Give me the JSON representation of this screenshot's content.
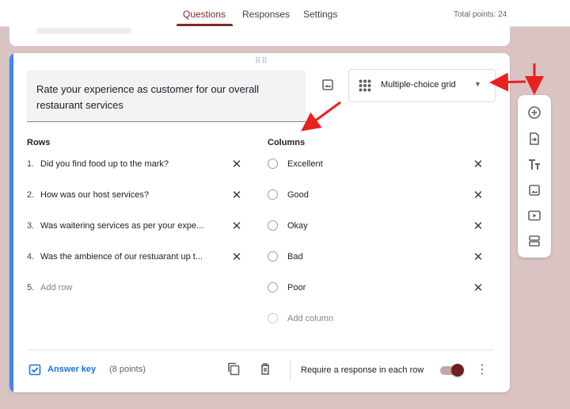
{
  "header": {
    "tabs": [
      {
        "label": "Questions",
        "active": true
      },
      {
        "label": "Responses",
        "active": false
      },
      {
        "label": "Settings",
        "active": false
      }
    ],
    "total_points": "Total points: 24"
  },
  "question": {
    "title": "Rate your experience as customer for our overall restaurant services",
    "type": "Multiple-choice grid",
    "rows_heading": "Rows",
    "columns_heading": "Columns",
    "rows": [
      {
        "num": "1.",
        "label": "Did you find food up to the mark?"
      },
      {
        "num": "2.",
        "label": "How was our host services?"
      },
      {
        "num": "3.",
        "label": "Was waitering services as per your expe..."
      },
      {
        "num": "4.",
        "label": "Was the ambience of our restuarant up t..."
      }
    ],
    "add_row": {
      "num": "5.",
      "label": "Add row"
    },
    "columns": [
      "Excellent",
      "Good",
      "Okay",
      "Bad",
      "Poor"
    ],
    "add_column": "Add column",
    "answer_key": "Answer key",
    "points": "(8 points)",
    "required_label": "Require a response in each row",
    "required_on": true
  },
  "toolbar": {
    "tools": [
      "add-question-icon",
      "import-questions-icon",
      "add-title-icon",
      "add-image-icon",
      "add-video-icon",
      "add-section-icon"
    ]
  },
  "colors": {
    "accent_blue": "#4285f4",
    "theme_maroon": "#6e1f1f",
    "annotation_red": "#e8221f",
    "background": "#d9c3c3"
  }
}
